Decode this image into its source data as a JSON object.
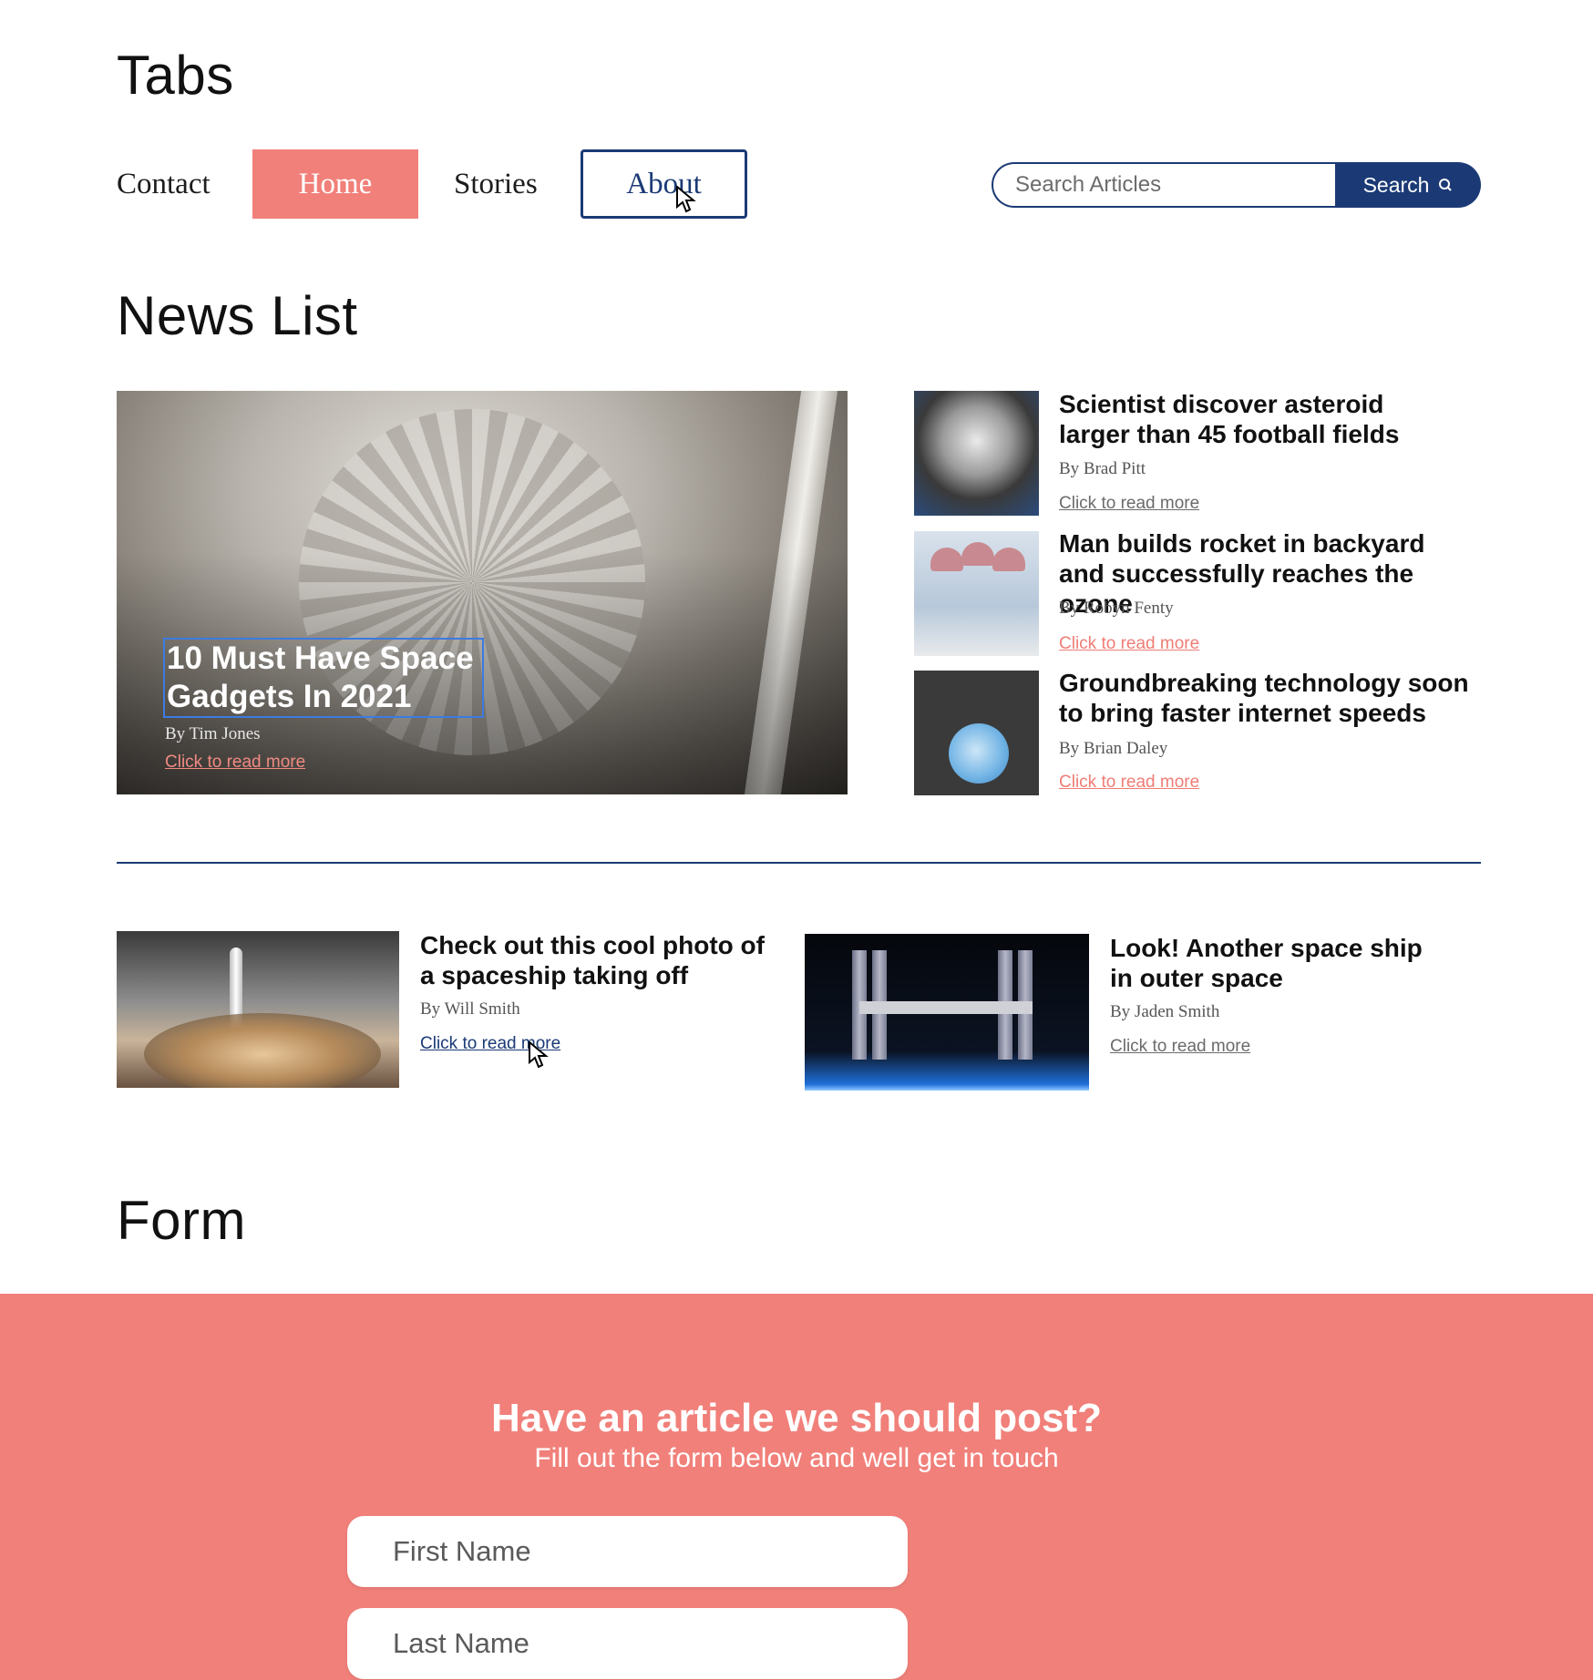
{
  "sections": {
    "tabs_title": "Tabs",
    "news_title": "News List",
    "form_title": "Form"
  },
  "tabs": {
    "items": [
      {
        "label": "Contact",
        "state": "default"
      },
      {
        "label": "Home",
        "state": "active"
      },
      {
        "label": "Stories",
        "state": "default"
      },
      {
        "label": "About",
        "state": "focused"
      }
    ]
  },
  "search": {
    "placeholder": "Search Articles",
    "value": "",
    "button_label": "Search",
    "button_icon": "search-icon"
  },
  "featured": {
    "title": "10 Must Have Space Gadgets In 2021",
    "author": "By Tim Jones",
    "read_more": "Click to read more"
  },
  "side_articles": [
    {
      "title": "Scientist discover asteroid larger than 45 football fields",
      "author": "By Brad Pitt",
      "read_more": "Click to read more"
    },
    {
      "title": "Man builds rocket in backyard and successfully reaches the ozone",
      "author": "By Robyn Fenty",
      "read_more": "Click to read more"
    },
    {
      "title": "Groundbreaking technology soon to bring faster internet speeds",
      "author": "By Brian Daley",
      "read_more": "Click to read more"
    }
  ],
  "bottom_articles": [
    {
      "title": "Check out this cool photo of a spaceship taking off",
      "author": "By Will Smith",
      "read_more": "Click to read more"
    },
    {
      "title": "Look! Another space ship in outer space",
      "author": "By Jaden Smith",
      "read_more": "Click to read more"
    }
  ],
  "form": {
    "heading": "Have an article we should post?",
    "subheading": "Fill out the form below and well get in touch",
    "first_name_placeholder": "First Name",
    "last_name_placeholder": "Last Name"
  },
  "colors": {
    "accent": "#f1807a",
    "navy": "#1b3a75",
    "link_gray": "#6b6b6b"
  }
}
